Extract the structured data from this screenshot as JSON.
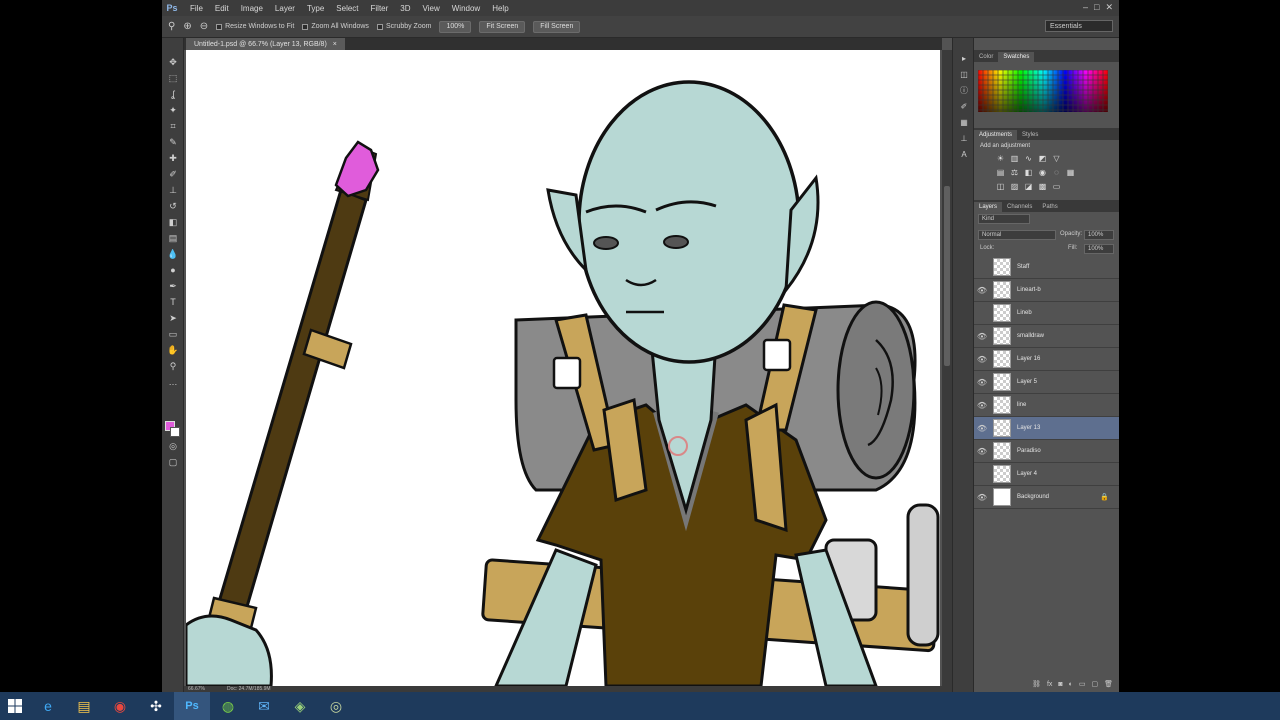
{
  "menubar": {
    "logo": "Ps",
    "items": [
      "File",
      "Edit",
      "Image",
      "Layer",
      "Type",
      "Select",
      "Filter",
      "3D",
      "View",
      "Window",
      "Help"
    ]
  },
  "options": {
    "resize_windows": "Resize Windows to Fit",
    "zoom_all": "Zoom All Windows",
    "scrubby_zoom": "Scrubby Zoom",
    "btn_100": "100%",
    "btn_fit": "Fit Screen",
    "btn_fill": "Fill Screen",
    "workspace": "Essentials"
  },
  "document": {
    "tab_title": "Untitled-1.psd @ 66.7% (Layer 13, RGB/8)",
    "zoom": "66.67%",
    "doc_size": "Doc: 24.7M/185.9M"
  },
  "panels": {
    "swatch_tabs": [
      "Color",
      "Swatches"
    ],
    "adjust_tabs": [
      "Adjustments",
      "Styles"
    ],
    "adjust_label": "Add an adjustment",
    "layer_tabs": [
      "Layers",
      "Channels",
      "Paths"
    ],
    "kind": "Kind",
    "blend_mode": "Normal",
    "opacity_label": "Opacity:",
    "opacity": "100%",
    "fill_label": "Fill:",
    "fill": "100%",
    "lock_label": "Lock:"
  },
  "layers": [
    {
      "name": "Staff",
      "visible": false,
      "selected": false
    },
    {
      "name": "Lineart-b",
      "visible": true,
      "selected": false
    },
    {
      "name": "Lineb",
      "visible": false,
      "selected": false
    },
    {
      "name": "smalldraw",
      "visible": true,
      "selected": false
    },
    {
      "name": "Layer 16",
      "visible": true,
      "selected": false
    },
    {
      "name": "Layer 5",
      "visible": true,
      "selected": false
    },
    {
      "name": "line",
      "visible": true,
      "selected": false
    },
    {
      "name": "Layer 13",
      "visible": true,
      "selected": true
    },
    {
      "name": "Paradiso",
      "visible": true,
      "selected": false
    },
    {
      "name": "Layer 4",
      "visible": false,
      "selected": false
    },
    {
      "name": "Background",
      "visible": true,
      "selected": false,
      "locked": true
    }
  ],
  "colors": {
    "foreground": "#e05cdb",
    "background": "#ffffff",
    "skin": "#b7d8d4",
    "shirt": "#5a410a",
    "strap": "#c8a55a",
    "bedroll": "#8a8a8a",
    "staff": "#4e3a12",
    "crystal": "#e05cdb"
  },
  "taskbar": {
    "apps": [
      "start-icon",
      "ie-icon",
      "explorer-icon",
      "chrome-icon",
      "app-icon",
      "photoshop-icon",
      "spotify-icon",
      "mail-icon",
      "app2-icon",
      "app3-icon"
    ]
  }
}
